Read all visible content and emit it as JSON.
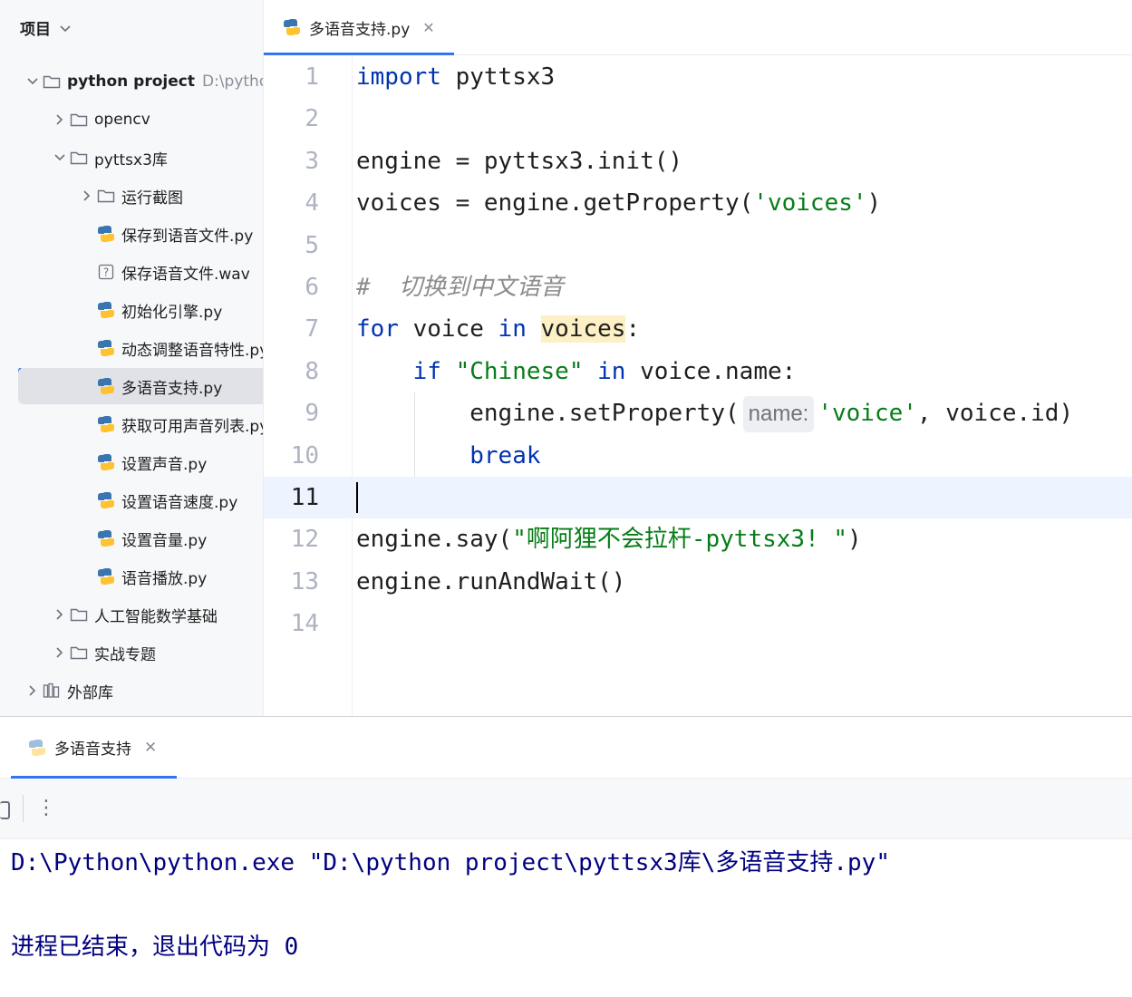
{
  "sidebar": {
    "title": "项目",
    "project": {
      "name": "python project",
      "path": "D:\\python"
    },
    "items": [
      {
        "label": "opencv",
        "type": "folder"
      },
      {
        "label": "pyttsx3库",
        "type": "folder"
      },
      {
        "label": "运行截图",
        "type": "folder"
      },
      {
        "label": "保存到语音文件.py",
        "type": "python"
      },
      {
        "label": "保存语音文件.wav",
        "type": "unknown"
      },
      {
        "label": "初始化引擎.py",
        "type": "python"
      },
      {
        "label": "动态调整语音特性.py",
        "type": "python"
      },
      {
        "label": "多语音支持.py",
        "type": "python"
      },
      {
        "label": "获取可用声音列表.py",
        "type": "python"
      },
      {
        "label": "设置声音.py",
        "type": "python"
      },
      {
        "label": "设置语音速度.py",
        "type": "python"
      },
      {
        "label": "设置音量.py",
        "type": "python"
      },
      {
        "label": "语音播放.py",
        "type": "python"
      },
      {
        "label": "人工智能数学基础",
        "type": "folder"
      },
      {
        "label": "实战专题",
        "type": "folder"
      },
      {
        "label": "外部库",
        "type": "library"
      }
    ]
  },
  "editor": {
    "tab_label": "多语音支持.py",
    "current_line": 11,
    "lines": [
      [
        {
          "t": "import",
          "c": "kw"
        },
        {
          "t": " pyttsx3"
        }
      ],
      [],
      [
        {
          "t": "engine = pyttsx3.init()"
        }
      ],
      [
        {
          "t": "voices = engine.getProperty("
        },
        {
          "t": "'voices'",
          "c": "str"
        },
        {
          "t": ")"
        }
      ],
      [],
      [
        {
          "t": "#  切换到中文语音",
          "c": "cm"
        }
      ],
      [
        {
          "t": "for",
          "c": "kw"
        },
        {
          "t": " voice "
        },
        {
          "t": "in",
          "c": "kw"
        },
        {
          "t": " "
        },
        {
          "t": "voices",
          "c": "hl"
        },
        {
          "t": ":"
        }
      ],
      [
        {
          "t": "    "
        },
        {
          "t": "if",
          "c": "kw"
        },
        {
          "t": " "
        },
        {
          "t": "\"Chinese\"",
          "c": "str"
        },
        {
          "t": " "
        },
        {
          "t": "in",
          "c": "kw"
        },
        {
          "t": " voice.name:"
        }
      ],
      [
        {
          "t": "        engine.setProperty("
        },
        {
          "t": "name:",
          "c": "inlay"
        },
        {
          "t": "'voice'",
          "c": "str"
        },
        {
          "t": ", voice.id)"
        }
      ],
      [
        {
          "t": "        "
        },
        {
          "t": "break",
          "c": "kw"
        }
      ],
      [
        {
          "t": "",
          "c": "caret"
        }
      ],
      [
        {
          "t": "engine.say("
        },
        {
          "t": "\"啊阿狸不会拉杆-pyttsx3! \"",
          "c": "str"
        },
        {
          "t": ")"
        }
      ],
      [
        {
          "t": "engine.runAndWait()"
        }
      ],
      []
    ]
  },
  "run": {
    "tab_label": "多语音支持",
    "console": [
      "D:\\Python\\python.exe \"D:\\python project\\pyttsx3库\\多语音支持.py\"",
      "进程已结束，退出代码为 0"
    ]
  },
  "colors": {
    "accent": "#3574f0",
    "keyword": "#0033b3",
    "string": "#067d17",
    "comment": "#8c8c8c",
    "console": "#000080"
  }
}
